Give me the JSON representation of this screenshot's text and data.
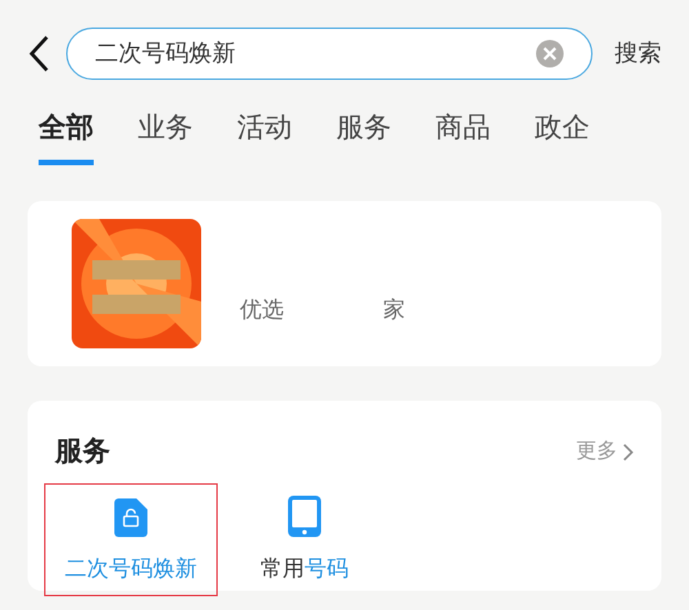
{
  "search": {
    "value": "二次号码焕新",
    "action": "搜索"
  },
  "tabs": [
    {
      "label": "全部",
      "selected": true
    },
    {
      "label": "业务",
      "selected": false
    },
    {
      "label": "活动",
      "selected": false
    },
    {
      "label": "服务",
      "selected": false
    },
    {
      "label": "商品",
      "selected": false
    },
    {
      "label": "政企",
      "selected": false
    }
  ],
  "promo": {
    "subtitle_parts": [
      "优选",
      "家"
    ]
  },
  "services": {
    "title": "服务",
    "more": "更多",
    "items": [
      {
        "kind": "sim",
        "selected": true,
        "label_parts": [
          {
            "text": "二次号码焕新",
            "match": true
          }
        ]
      },
      {
        "kind": "phone",
        "selected": false,
        "label_parts": [
          {
            "text": "常用",
            "match": false
          },
          {
            "text": "号码",
            "match": true
          }
        ]
      }
    ]
  }
}
